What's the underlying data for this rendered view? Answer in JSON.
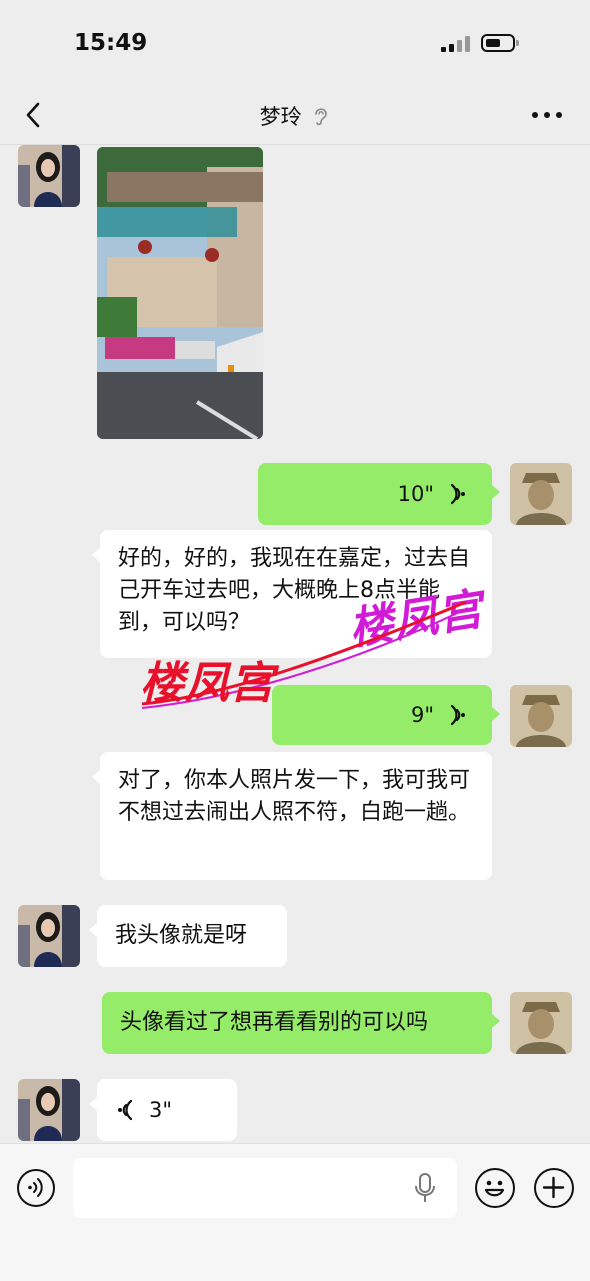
{
  "status_bar": {
    "time": "15:49"
  },
  "nav": {
    "title": "梦玲"
  },
  "messages": {
    "voice1_duration": "10\"",
    "text1": "好的，好的，我现在在嘉定，过去自己开车过去吧，大概晚上8点半能到，可以吗？",
    "voice2_duration": "9\"",
    "text2": "对了，你本人照片发一下，我可我可不想过去闹出人照不符，白跑一趟。",
    "reply1": "我头像就是呀",
    "text3": "头像看过了想再看看别的可以吗",
    "voice3_duration": "3\""
  },
  "watermark": {
    "text": "楼凤宫",
    "color_red": "#e8102a",
    "color_magenta": "#d21bd6"
  },
  "colors": {
    "sent_bubble": "#95ec69",
    "received_bubble": "#ffffff",
    "background": "#ededed"
  },
  "icons": [
    "back-icon",
    "ear-icon",
    "more-icon",
    "voice-wave-icon",
    "voice-input-icon",
    "microphone-icon",
    "emoji-icon",
    "plus-icon"
  ]
}
